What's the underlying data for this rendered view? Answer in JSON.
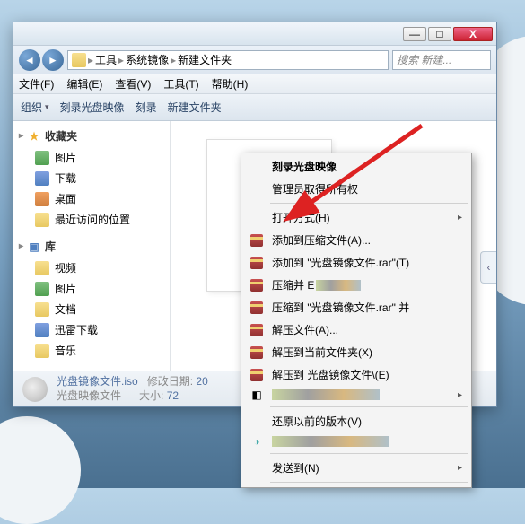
{
  "window_controls": {
    "min": "—",
    "max": "□",
    "close": "X"
  },
  "nav": {
    "back": "◄",
    "forward": "►"
  },
  "breadcrumb": [
    "工具",
    "系统镜像",
    "新建文件夹"
  ],
  "search_placeholder": "搜索 新建...",
  "menubar": [
    "文件(F)",
    "编辑(E)",
    "查看(V)",
    "工具(T)",
    "帮助(H)"
  ],
  "toolbar": {
    "organize": "组织",
    "burn": "刻录光盘映像",
    "action": "刻录",
    "newfolder": "新建文件夹"
  },
  "sidebar": {
    "favorites": {
      "label": "收藏夹",
      "items": [
        "图片",
        "下载",
        "桌面",
        "最近访问的位置"
      ]
    },
    "libraries": {
      "label": "库",
      "items": [
        "视频",
        "图片",
        "文档",
        "迅雷下载",
        "音乐"
      ]
    }
  },
  "status": {
    "filename": "光盘镜像文件.iso",
    "filetype": "光盘映像文件",
    "mod_label": "修改日期:",
    "mod_value": "20",
    "size_label": "大小:",
    "size_value": "72"
  },
  "context_menu": {
    "burn_image": "刻录光盘映像",
    "admin_own": "管理员取得所有权",
    "open_with": "打开方式(H)",
    "add_archive": "添加到压缩文件(A)...",
    "add_to_rar": "添加到 \"光盘镜像文件.rar\"(T)",
    "compress_and": "压缩并 E",
    "compress_to_and": "压缩到 \"光盘镜像文件.rar\" 并",
    "extract_files": "解压文件(A)...",
    "extract_here": "解压到当前文件夹(X)",
    "extract_to": "解压到 光盘镜像文件\\(E)",
    "restore_prev": "还原以前的版本(V)",
    "send_to": "发送到(N)"
  }
}
